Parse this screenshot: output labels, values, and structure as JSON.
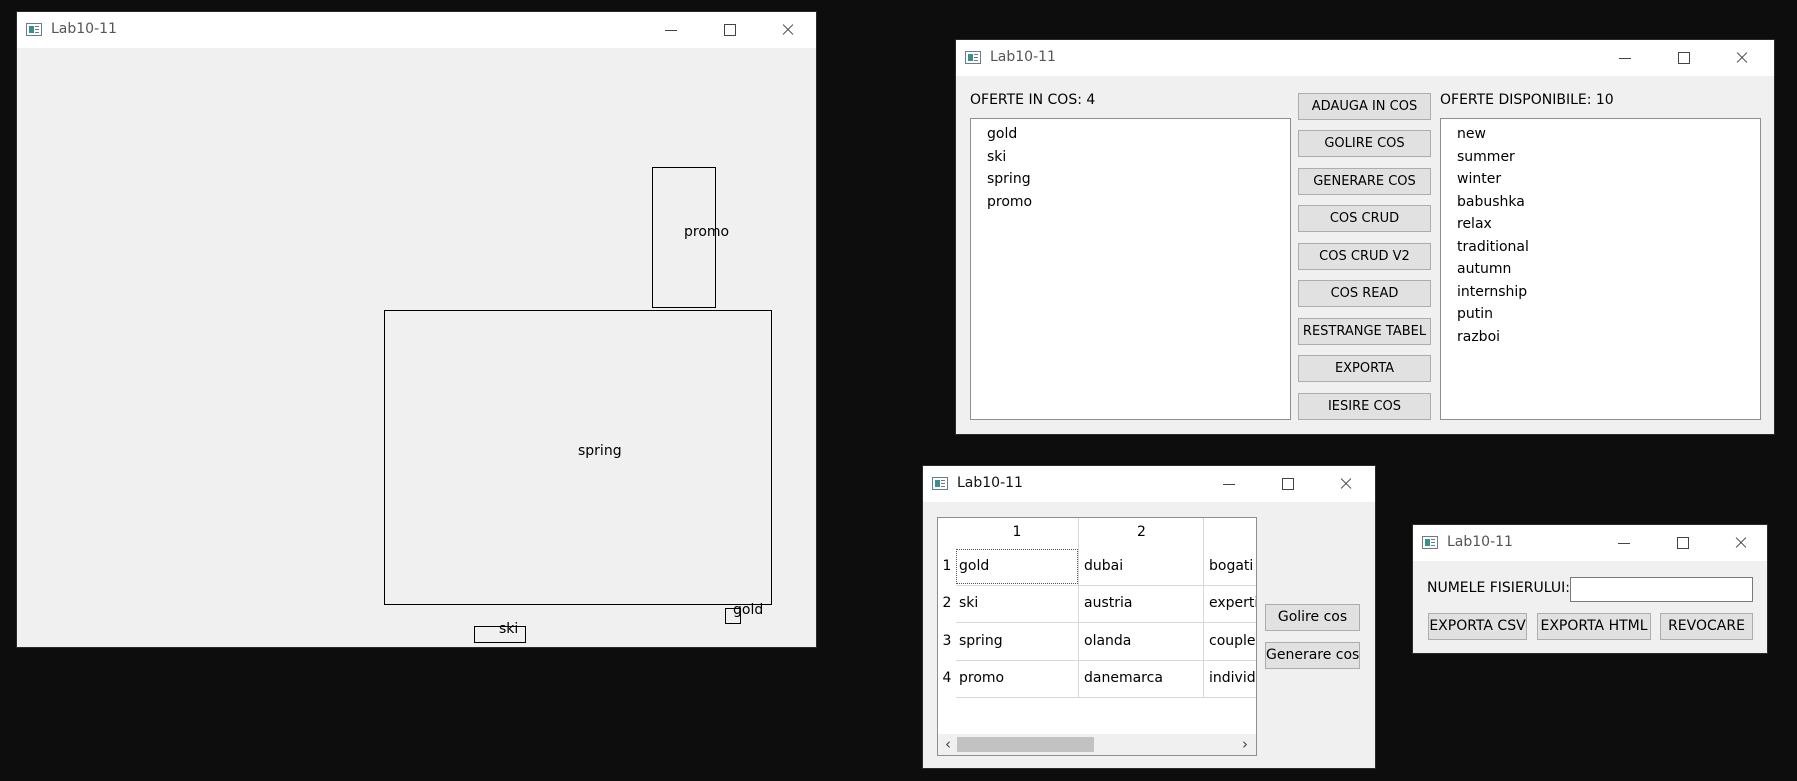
{
  "app_title": "Lab10-11",
  "drawing": {
    "shapes": [
      {
        "label": "promo"
      },
      {
        "label": "spring"
      },
      {
        "label": "gold"
      },
      {
        "label": "ski"
      }
    ]
  },
  "main": {
    "cart_header": "OFERTE IN COS: 4",
    "cart_items": [
      "gold",
      "ski",
      "spring",
      "promo"
    ],
    "buttons": [
      "ADAUGA IN COS",
      "GOLIRE COS",
      "GENERARE COS",
      "COS CRUD",
      "COS CRUD V2",
      "COS READ",
      "RESTRANGE TABEL",
      "EXPORTA",
      "IESIRE COS"
    ],
    "available_header": "OFERTE DISPONIBILE: 10",
    "available_items": [
      "new",
      "summer",
      "winter",
      "babushka",
      "relax",
      "traditional",
      "autumn",
      "internship",
      "putin",
      "razboi"
    ]
  },
  "table_window": {
    "column_headers": [
      "1",
      "2"
    ],
    "row_headers": [
      "1",
      "2",
      "3",
      "4"
    ],
    "rows": [
      [
        "gold",
        "dubai",
        "bogati"
      ],
      [
        "ski",
        "austria",
        "experti"
      ],
      [
        "spring",
        "olanda",
        "couple"
      ],
      [
        "promo",
        "danemarca",
        "individ"
      ]
    ],
    "scroll_left": "‹",
    "scroll_right": "›",
    "golire_label": "Golire cos",
    "generare_label": "Generare cos"
  },
  "export_window": {
    "filename_label": "NUMELE FISIERULUI:",
    "filename_value": "",
    "export_csv": "EXPORTA CSV",
    "export_html": "EXPORTA HTML",
    "cancel": "REVOCARE"
  }
}
